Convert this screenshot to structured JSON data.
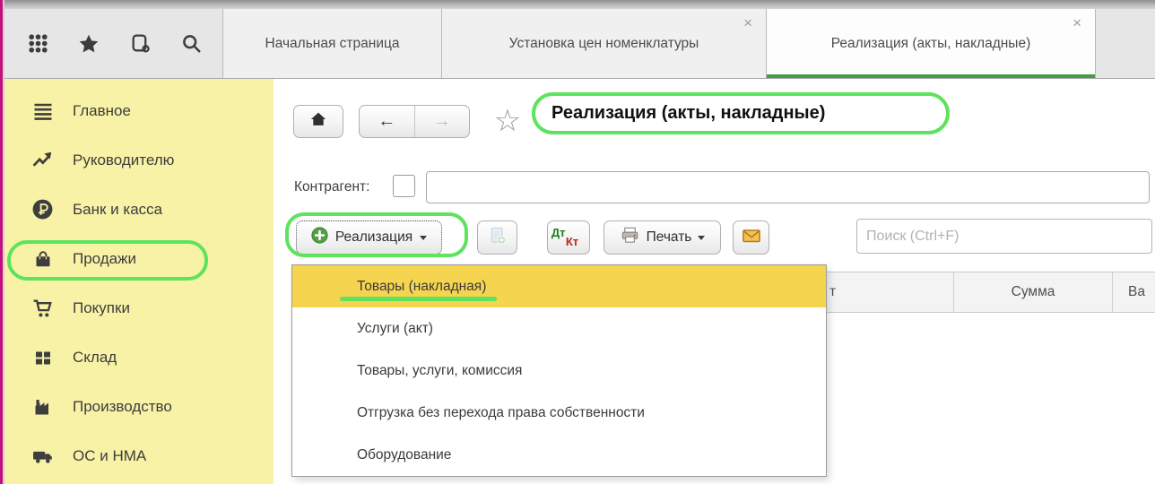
{
  "window": {
    "tabs": [
      {
        "label": "Начальная страница",
        "close": ""
      },
      {
        "label": "Установка цен номенклатуры",
        "close": "×"
      },
      {
        "label": "Реализация (акты, накладные)",
        "close": "×"
      }
    ]
  },
  "sidebar": {
    "items": [
      {
        "label": "Главное"
      },
      {
        "label": "Руководителю"
      },
      {
        "label": "Банк и касса"
      },
      {
        "label": "Продажи"
      },
      {
        "label": "Покупки"
      },
      {
        "label": "Склад"
      },
      {
        "label": "Производство"
      },
      {
        "label": "ОС и НМА"
      }
    ]
  },
  "main": {
    "nav": {
      "back": "←",
      "forward": "→",
      "favorite": "☆"
    },
    "page_title": "Реализация (акты, накладные)",
    "filter": {
      "label": "Контрагент:",
      "value": ""
    },
    "toolbar": {
      "create_label": "Реализация",
      "dt": "Дт",
      "kt": "Кт",
      "print_label": "Печать",
      "search_placeholder": "Поиск (Ctrl+F)"
    },
    "dropdown": {
      "items": [
        "Товары (накладная)",
        "Услуги (акт)",
        "Товары, услуги, комиссия",
        "Отгрузка без перехода права собственности",
        "Оборудование"
      ],
      "selected_index": 0
    },
    "table": {
      "headers": [
        "т",
        "Сумма",
        "Ва"
      ]
    }
  },
  "colors": {
    "annotation_green": "#5de35d",
    "active_tab_green": "#3f9e46",
    "sidebar_yellow": "#f8f2a6",
    "selected_item_yellow": "#f5d44f"
  }
}
